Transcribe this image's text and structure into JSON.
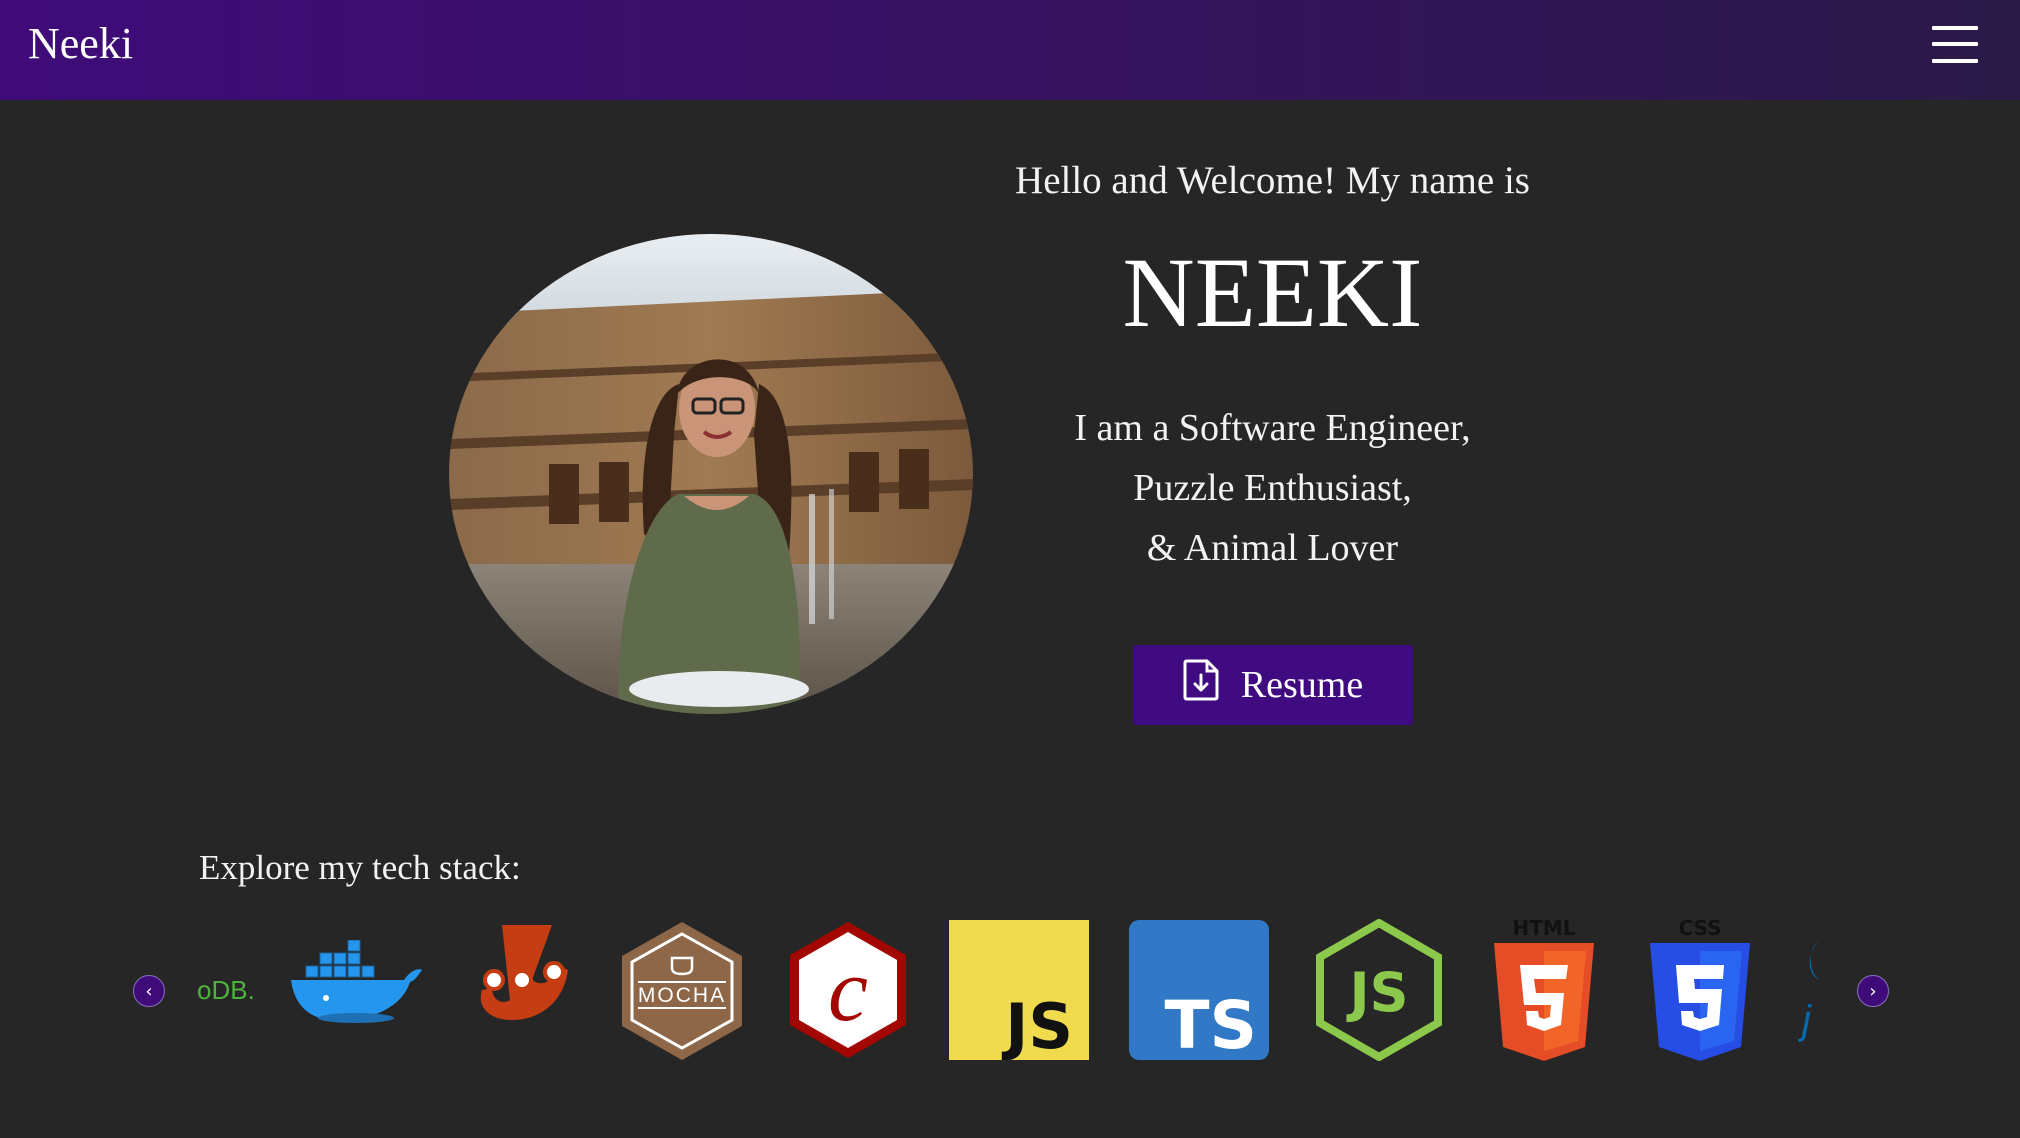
{
  "nav": {
    "brand": "Neeki",
    "menu_icon": "hamburger-menu-icon"
  },
  "hero": {
    "greeting": "Hello and Welcome! My name is",
    "name": "NEEKI",
    "tagline": [
      "I am a Software Engineer,",
      "Puzzle Enthusiast,",
      "& Animal Lover"
    ],
    "resume_label": "Resume",
    "resume_icon": "file-download-icon"
  },
  "tech": {
    "heading": "Explore my tech stack:",
    "prev_icon": "chevron-left-icon",
    "next_icon": "chevron-right-icon",
    "prev_glyph": "‹",
    "next_glyph": "›",
    "logos": [
      {
        "name": "mongodb-logo",
        "text": "oDB."
      },
      {
        "name": "docker-logo"
      },
      {
        "name": "jest-logo"
      },
      {
        "name": "mocha-logo",
        "text": "MOCHA"
      },
      {
        "name": "chai-logo",
        "text": "c"
      },
      {
        "name": "javascript-logo",
        "text": "JS"
      },
      {
        "name": "typescript-logo",
        "text": "TS"
      },
      {
        "name": "nodejs-logo",
        "text": "JS"
      },
      {
        "name": "html5-logo",
        "text": "HTML"
      },
      {
        "name": "css3-logo",
        "text": "CSS"
      },
      {
        "name": "jquery-logo",
        "text": "j"
      }
    ]
  },
  "colors": {
    "accent": "#400b80",
    "background": "#262626",
    "nav_start": "#3f0b79",
    "nav_end": "#2a1a48"
  }
}
